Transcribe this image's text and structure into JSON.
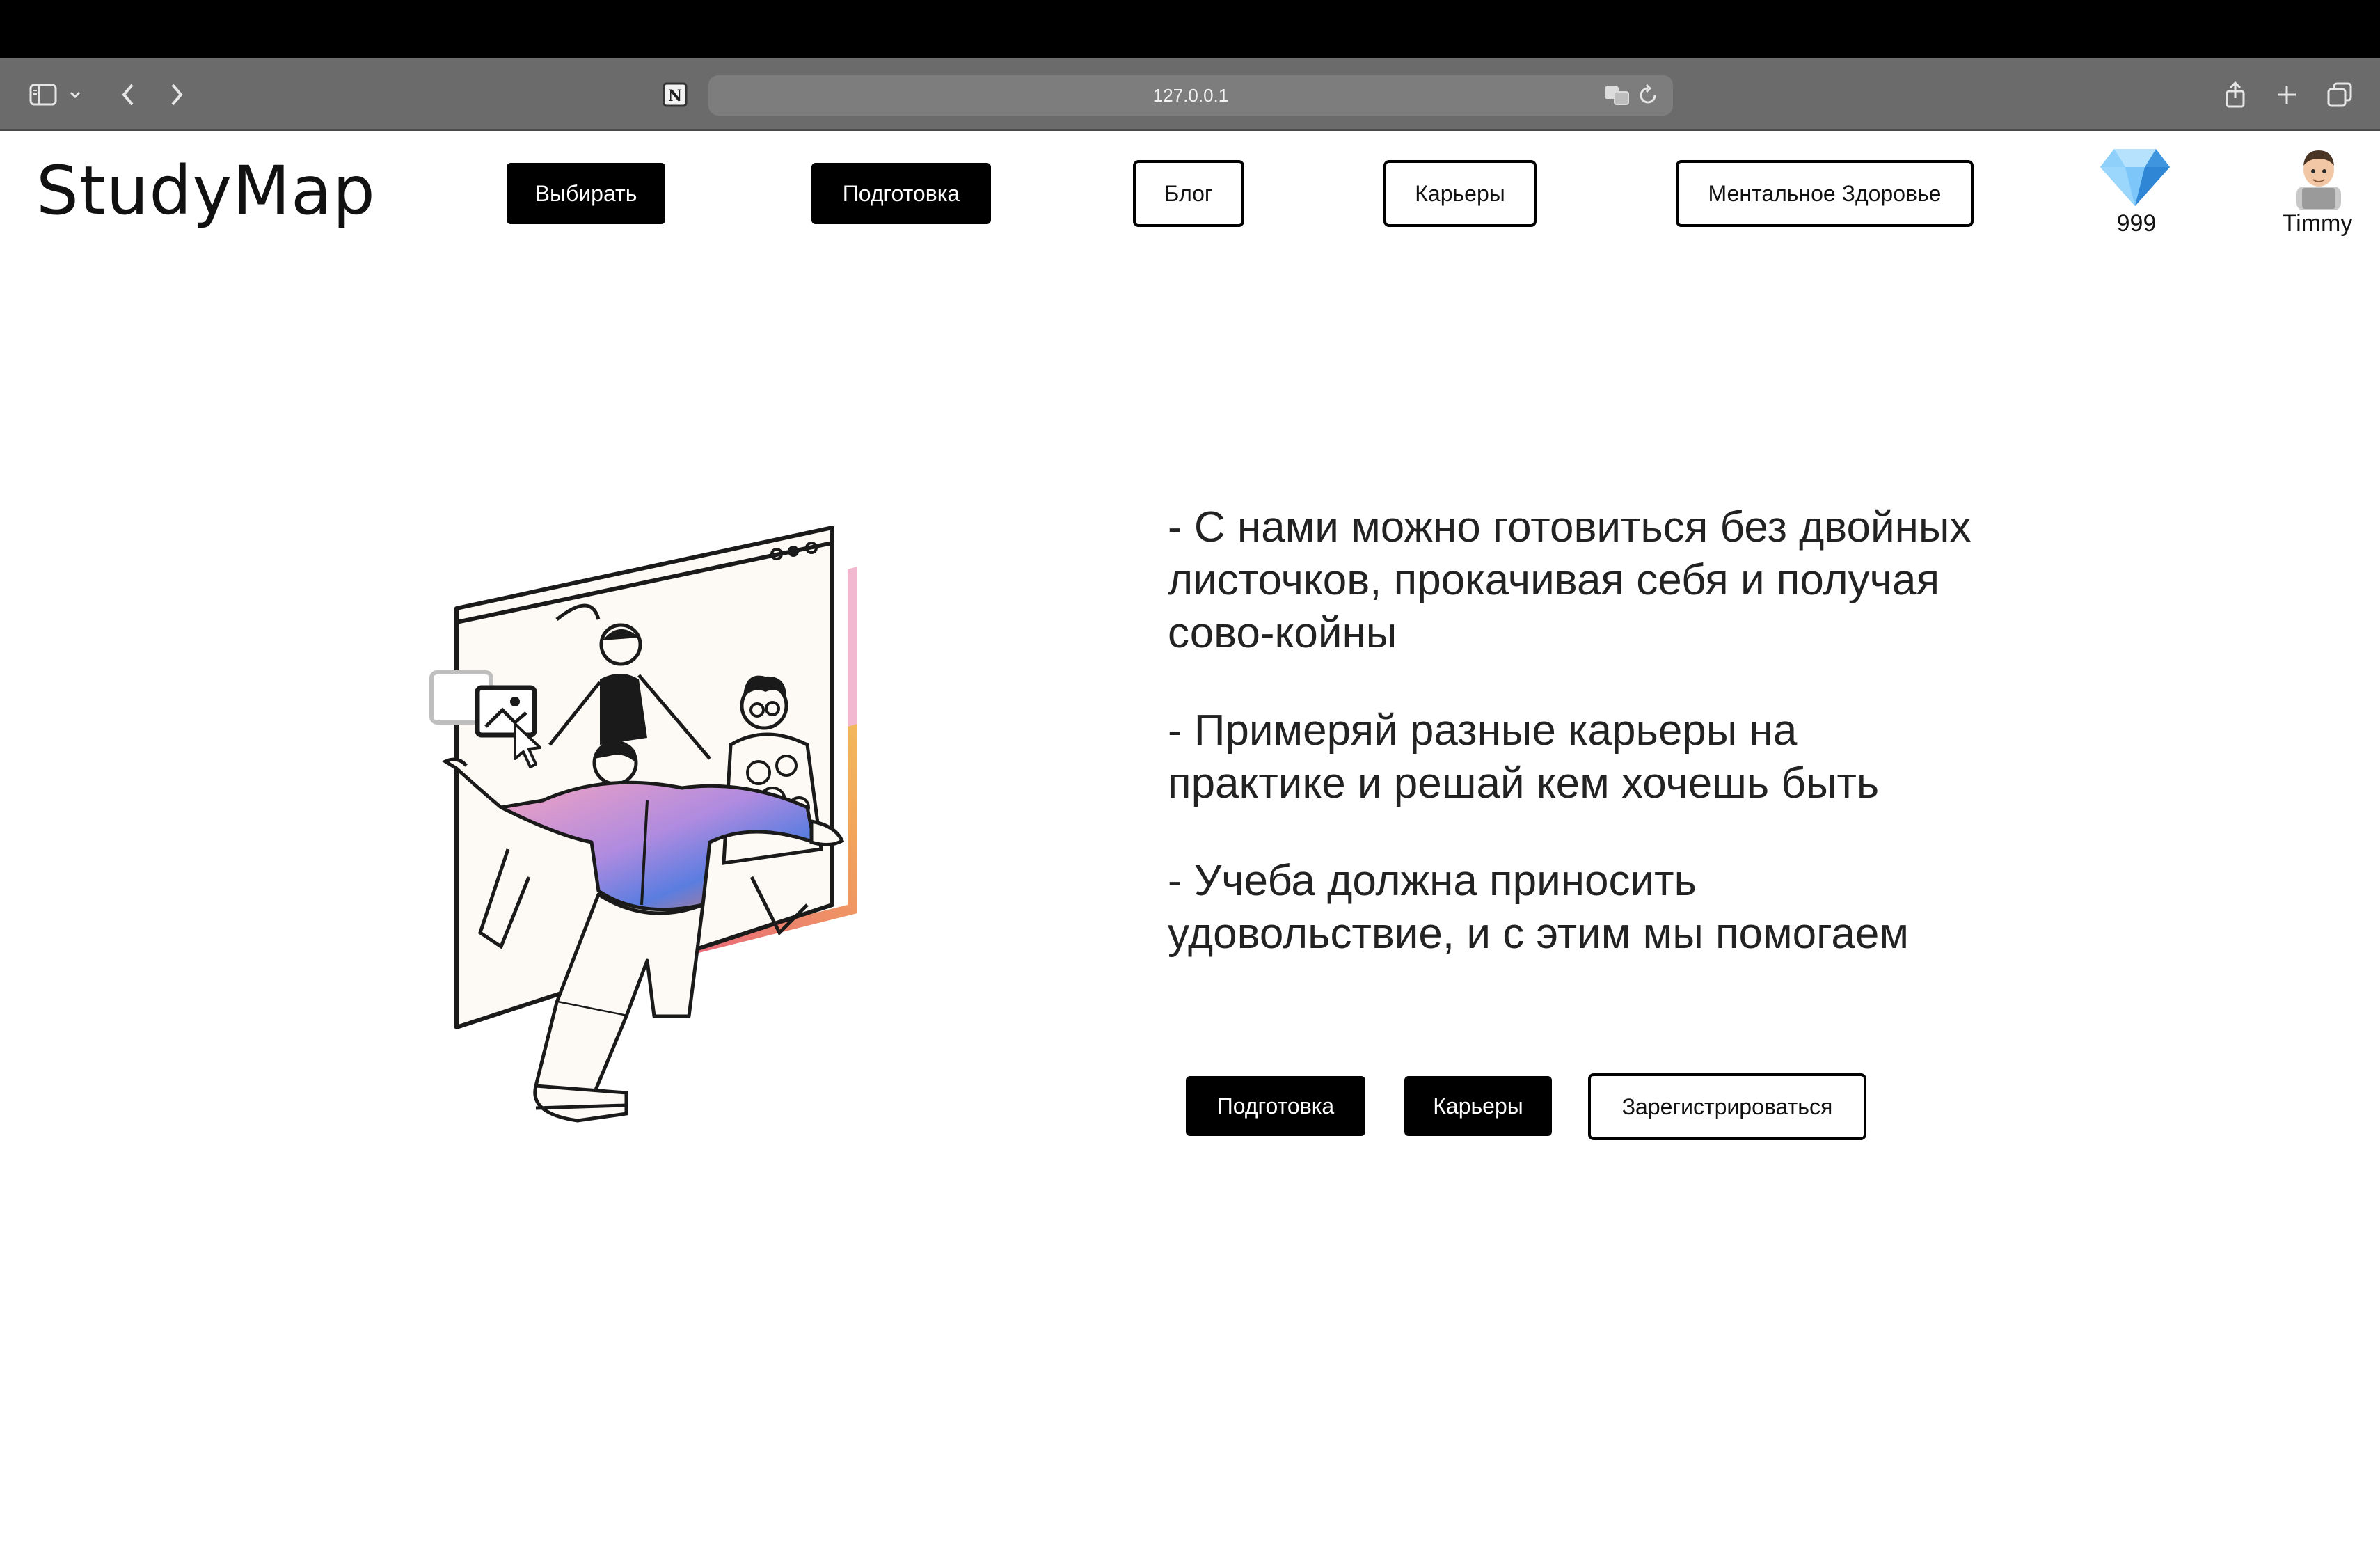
{
  "browser": {
    "url": "127.0.0.1"
  },
  "header": {
    "logo": "StudyMap",
    "nav": {
      "choose": "Выбирать",
      "prep": "Подготовка",
      "blog": "Блог",
      "careers": "Карьеры",
      "mental": "Ментальное Здоровье"
    },
    "gems": "999",
    "user": "Timmy"
  },
  "hero": {
    "points": [
      "- С нами можно готовиться без двойных листочков, прокачивая себя и получая сово-койны",
      "- Примеряй разные карьеры на практике и решай кем хочешь быть",
      "- Учеба должна приносить удовольствие, и с этим мы помогаем"
    ],
    "buttons": {
      "prep": "Подготовка",
      "careers": "Карьеры",
      "register": "Зарегистрироваться"
    }
  },
  "colors": {
    "toolbar": "#6b6b6b",
    "button_dark": "#000000",
    "gem": "#4aa3f0"
  }
}
